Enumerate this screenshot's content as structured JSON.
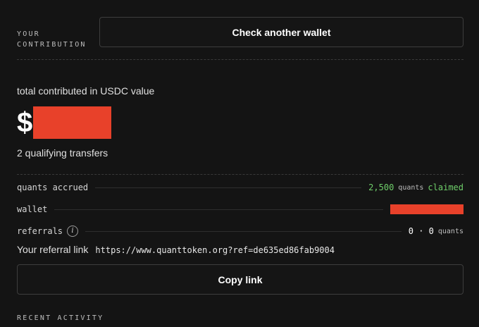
{
  "contribution": {
    "label_line1": "YOUR",
    "label_line2": "CONTRIBUTION",
    "check_wallet_button": "Check another wallet",
    "total_label": "total contributed in USDC value",
    "currency_symbol": "$",
    "transfers_text": "2 qualifying transfers"
  },
  "stats": {
    "quants_accrued": {
      "label": "quants accrued",
      "value": "2,500",
      "unit": "quants",
      "status": "claimed"
    },
    "wallet": {
      "label": "wallet"
    },
    "referrals": {
      "label": "referrals",
      "info_glyph": "i",
      "value": "0 · 0",
      "unit": "quants"
    }
  },
  "referral_link": {
    "label": "Your referral link",
    "url": "https://www.quanttoken.org?ref=de635ed86fab9004",
    "copy_button": "Copy link"
  },
  "recent_activity": {
    "label": "RECENT ACTIVITY"
  },
  "colors": {
    "background": "#141414",
    "accent_green": "#6fcf6a",
    "redaction": "#e8412a"
  }
}
